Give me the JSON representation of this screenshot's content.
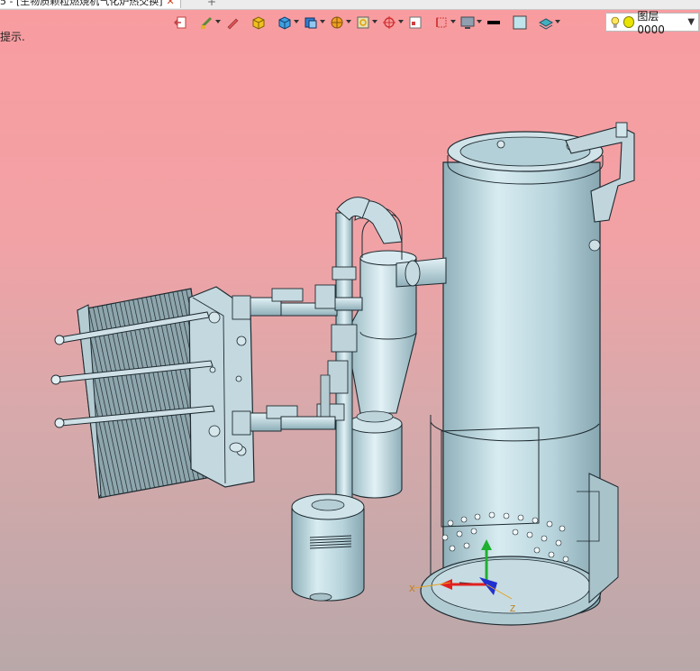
{
  "window": {
    "tab_title": "5 - [生物质颗粒燃烧机气化炉热交换]",
    "tab_close": "✕",
    "new_tab": "+"
  },
  "status": {
    "hint": "提示."
  },
  "toolbar": {
    "buttons": [
      {
        "name": "exit-icon"
      },
      {
        "name": "paint-brush-icon"
      },
      {
        "name": "pencil-icon"
      },
      {
        "name": "box-icon"
      },
      {
        "name": "cube-icon"
      },
      {
        "name": "view-cube-icon"
      },
      {
        "name": "sphere-icon"
      },
      {
        "name": "frame-icon"
      },
      {
        "name": "snap-target-icon"
      },
      {
        "name": "window-icon"
      },
      {
        "name": "selection-icon"
      },
      {
        "name": "monitor-icon"
      },
      {
        "name": "line-color-icon"
      },
      {
        "name": "fill-color-icon"
      },
      {
        "name": "layer-tool-icon"
      }
    ],
    "layer": {
      "label": "图层0000",
      "bulb_icon": "lightbulb-icon",
      "dot_color": "#e8e400",
      "arrow": "▼"
    }
  },
  "colors": {
    "background_top": "#f89ca0",
    "background_bottom": "#b9a8a9",
    "model_fill": "#b9d7df",
    "model_edge": "#1e2a30",
    "axis_x": "#e02020",
    "axis_y": "#20b030",
    "axis_z": "#2030d0"
  }
}
